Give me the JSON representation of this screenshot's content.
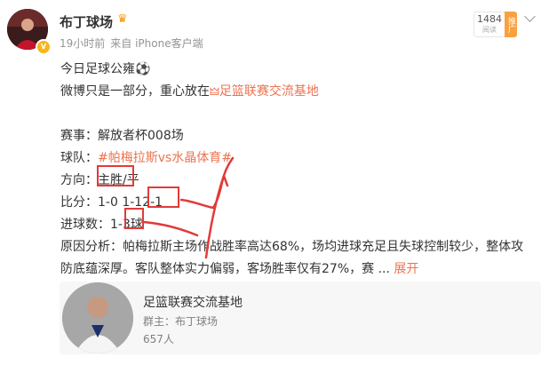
{
  "post_header": {
    "username": "布丁球场",
    "time": "19小时前",
    "source": "来自 iPhone客户端",
    "read_count": "1484",
    "read_label": "阅读",
    "promo_label": "推广"
  },
  "post_body": {
    "line1": "今日足球公雍⚽",
    "line2_text": "微博只是一部分，重心放在",
    "line2_link": "足篮联赛交流基地",
    "match_label": "赛事：",
    "match_value": "解放者杯008场",
    "teams_label": "球队：",
    "teams_value": "#帕梅拉斯vs水晶体育#",
    "direction_label": "方向：",
    "direction_boxed": "主胜",
    "direction_rest": "/平",
    "score_label": "比分：",
    "score_plain": "1-0 1-1",
    "score_boxed": "2-1",
    "goals_label": "进球数：",
    "goals_plain": "1-",
    "goals_boxed": "3",
    "goals_suffix": "球",
    "reason": "原因分析：帕梅拉斯主场作战胜率高达68%，场均进球充足且失球控制较少，整体攻防底蕴深厚。客队整体实力偏弱，客场胜率仅有27%，赛",
    "ellipsis": "...",
    "expand": "展开"
  },
  "group_card": {
    "title": "足篮联赛交流基地",
    "owner": "群主：布丁球场",
    "members": "657人"
  },
  "colors": {
    "link": "#eb7350",
    "annotation": "#e23a3a",
    "promo": "#f9a13e"
  },
  "icons": [
    "crown-icon",
    "verified-badge-icon",
    "chevron-down-icon",
    "link-icon"
  ]
}
